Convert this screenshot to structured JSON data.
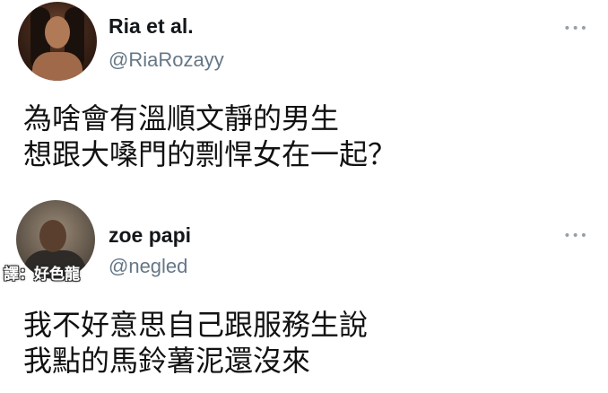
{
  "tweets": [
    {
      "name": "Ria et al.",
      "handle": "@RiaRozayy",
      "more": "•••",
      "lines": [
        "為啥會有溫順文靜的男生",
        "想跟大嗓門的剽悍女在一起？"
      ]
    },
    {
      "name": "zoe papi",
      "handle": "@negled",
      "more": "•••",
      "watermark": "譯：好色龍",
      "lines": [
        "我不好意思自己跟服務生說",
        "我點的馬鈴薯泥還沒來"
      ]
    }
  ],
  "colors": {
    "name": "#14171a",
    "handle": "#657786",
    "text": "#111111",
    "more_icon": "#98a0a6"
  },
  "icons": [
    "more-options-icon",
    "avatar"
  ]
}
